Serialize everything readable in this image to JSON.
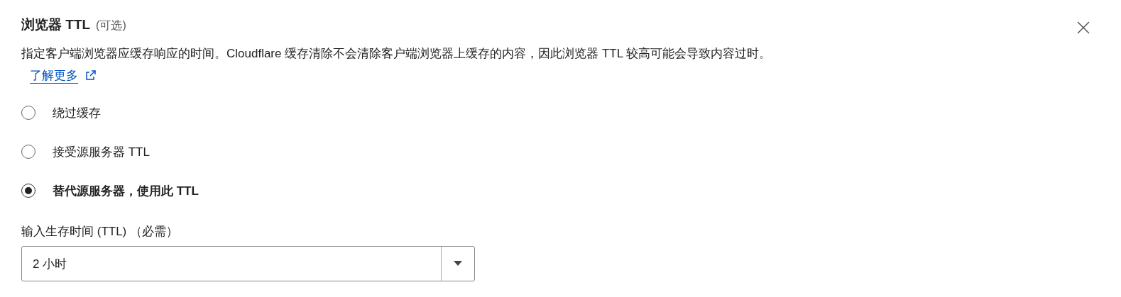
{
  "title": "浏览器 TTL",
  "title_note": "(可选)",
  "description": "指定客户端浏览器应缓存响应的时间。Cloudflare 缓存清除不会清除客户端浏览器上缓存的内容，因此浏览器 TTL 较高可能会导致内容过时。",
  "learn_more": "了解更多",
  "options": [
    {
      "label": "绕过缓存",
      "selected": false
    },
    {
      "label": "接受源服务器 TTL",
      "selected": false
    },
    {
      "label": "替代源服务器，使用此 TTL",
      "selected": true
    }
  ],
  "ttl_field": {
    "label": "输入生存时间 (TTL) （必需）",
    "value": "2 小时"
  }
}
